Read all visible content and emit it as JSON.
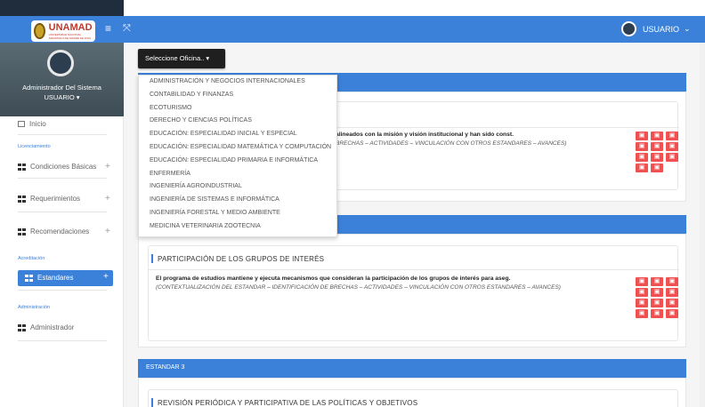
{
  "header": {
    "logo_text": "UNAMAD",
    "logo_subtitle": "UNIVERSIDAD NACIONAL AMAZÓNICA DE MADRE DE DIOS",
    "menu_icon": "hamburger-icon",
    "expand_icon": "expand-icon",
    "user_label": "USUARIO",
    "user_caret": "⌄",
    "accent": "#3b80d9"
  },
  "sidebar": {
    "profile_name": "Administrador Del Sistema",
    "profile_user": "USUARIO ▾",
    "home_label": "Inicio",
    "sections": {
      "licensing": "Licenciamiento",
      "accreditation": "Acreditación",
      "administration": "Administración"
    },
    "items": {
      "basic_conditions": "Condiciones Básicas",
      "requirements": "Requerimientos",
      "recommendations": "Recomendaciones",
      "standards": "Estandares",
      "administrator": "Administrador"
    },
    "plus": "+"
  },
  "selector": {
    "label": "Seleccione Oficina.. ▾",
    "options": [
      "ADMINISTRACIÓN Y NEGOCIOS INTERNACIONALES",
      "CONTABILIDAD Y FINANZAS",
      "ECOTURISMO",
      "DERECHO Y CIENCIAS POLÍTICAS",
      "EDUCACIÓN: ESPECIALIDAD INICIAL Y ESPECIAL",
      "EDUCACIÓN: ESPECIALIDAD MATEMÁTICA Y COMPUTACIÓN",
      "EDUCACIÓN: ESPECIALIDAD PRIMARIA E INFORMÁTICA",
      "ENFERMERÍA",
      "INGENIERÍA AGROINDUSTRIAL",
      "INGENIERÍA DE SISTEMAS E INFORMÁTICA",
      "INGENIERÍA FORESTAL Y MEDIO AMBIENTE",
      "MEDICINA VETERINARIA ZOOTECNIA"
    ]
  },
  "main": {
    "std1_text": "alineados con la misión y visión institucional y han sido const.",
    "std1_sub": "BRECHAS – ACTIVIDADES – VINCULACIÓN CON OTROS ESTANDARES – AVANCES)",
    "std2_card_title": "PARTICIPACIÓN DE LOS GRUPOS DE INTERÉS",
    "std2_text": "El programa de estudios mantiene y ejecuta mecanismos que consideran la participación de los grupos de interés para aseg.",
    "std2_sub": "(CONTEXTUALIZACIÓN DEL ESTANDAR – IDENTIFICACIÓN DE BRECHAS – ACTIVIDADES – VINCULACIÓN CON OTROS ESTANDARES – AVANCES)",
    "std3_header": "ESTANDAR 3",
    "std3_card_title": "REVISIÓN PERIÓDICA Y PARTICIPATIVA DE LAS POLÍTICAS Y OBJETIVOS",
    "file_icon": "document-icon",
    "danger_color": "#f05050"
  }
}
